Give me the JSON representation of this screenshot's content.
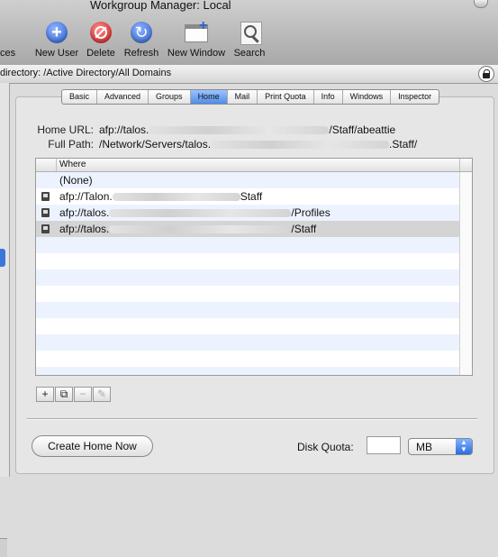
{
  "window": {
    "title": "Workgroup Manager: Local"
  },
  "toolbar": {
    "partial_label": "ces",
    "items": [
      {
        "label": "New User",
        "icon": "new-user-icon"
      },
      {
        "label": "Delete",
        "icon": "delete-icon"
      },
      {
        "label": "Refresh",
        "icon": "refresh-icon"
      },
      {
        "label": "New Window",
        "icon": "new-window-icon"
      },
      {
        "label": "Search",
        "icon": "search-icon"
      }
    ]
  },
  "directory": {
    "text": "directory:  /Active Directory/All Domains",
    "lock_icon": "lock-icon"
  },
  "tabs": [
    "Basic",
    "Advanced",
    "Groups",
    "Home",
    "Mail",
    "Print Quota",
    "Info",
    "Windows",
    "Inspector"
  ],
  "active_tab": "Home",
  "home": {
    "url_label": "Home URL:",
    "url_prefix": "afp://talos.",
    "url_suffix": "/Staff/abeattie",
    "path_label": "Full Path:",
    "path_prefix": "/Network/Servers/talos.",
    "path_suffix": ".Staff/"
  },
  "table": {
    "header": "Where",
    "rows": [
      {
        "prefix": "(None)",
        "suffix": "",
        "has_icon": false
      },
      {
        "prefix": "afp://Talon.",
        "suffix": "Staff",
        "has_icon": true
      },
      {
        "prefix": "afp://talos.",
        "suffix": "/Profiles",
        "has_icon": true
      },
      {
        "prefix": "afp://talos.",
        "suffix": "/Staff",
        "has_icon": true,
        "selected": true
      }
    ]
  },
  "list_buttons": {
    "add": "+",
    "duplicate": "⧉",
    "remove": "−",
    "edit": "✎"
  },
  "create_button": "Create Home Now",
  "quota": {
    "label": "Disk Quota:",
    "value": "",
    "unit": "MB"
  },
  "colors": {
    "selection": "#4f8ce8",
    "stripe": "#edf3fe"
  }
}
